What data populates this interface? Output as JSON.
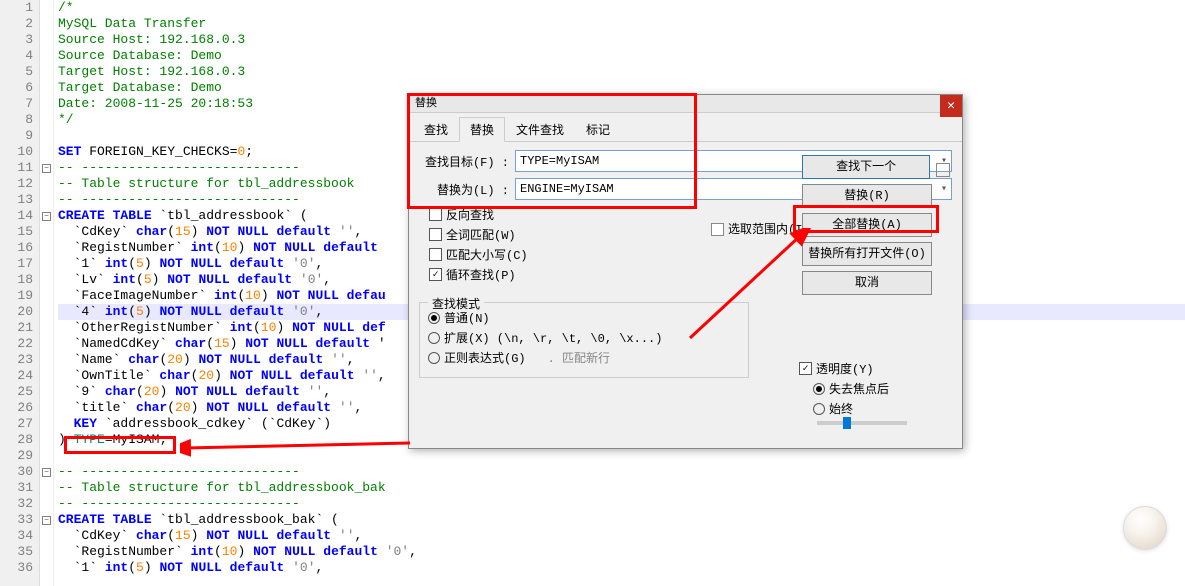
{
  "editor": {
    "lines": [
      {
        "n": 1,
        "f": "",
        "seg": [
          {
            "c": "c-comment",
            "t": "/*"
          }
        ]
      },
      {
        "n": 2,
        "f": "",
        "seg": [
          {
            "c": "c-comment",
            "t": "MySQL Data Transfer"
          }
        ]
      },
      {
        "n": 3,
        "f": "",
        "seg": [
          {
            "c": "c-comment",
            "t": "Source Host: 192.168.0.3"
          }
        ]
      },
      {
        "n": 4,
        "f": "",
        "seg": [
          {
            "c": "c-comment",
            "t": "Source Database: Demo"
          }
        ]
      },
      {
        "n": 5,
        "f": "",
        "seg": [
          {
            "c": "c-comment",
            "t": "Target Host: 192.168.0.3"
          }
        ]
      },
      {
        "n": 6,
        "f": "",
        "seg": [
          {
            "c": "c-comment",
            "t": "Target Database: Demo"
          }
        ]
      },
      {
        "n": 7,
        "f": "",
        "seg": [
          {
            "c": "c-comment",
            "t": "Date: 2008-11-25 20:18:53"
          }
        ]
      },
      {
        "n": 8,
        "f": "",
        "seg": [
          {
            "c": "c-comment",
            "t": "*/"
          }
        ]
      },
      {
        "n": 9,
        "f": "",
        "seg": [
          {
            "c": "",
            "t": ""
          }
        ]
      },
      {
        "n": 10,
        "f": "",
        "seg": [
          {
            "c": "c-kw",
            "t": "SET"
          },
          {
            "c": "",
            "t": " FOREIGN_KEY_CHECKS="
          },
          {
            "c": "c-num",
            "t": "0"
          },
          {
            "c": "",
            "t": ";"
          }
        ]
      },
      {
        "n": 11,
        "f": "-",
        "seg": [
          {
            "c": "c-comment",
            "t": "-- ----------------------------"
          }
        ]
      },
      {
        "n": 12,
        "f": "",
        "seg": [
          {
            "c": "c-comment",
            "t": "-- Table structure for tbl_addressbook"
          }
        ]
      },
      {
        "n": 13,
        "f": "",
        "seg": [
          {
            "c": "c-comment",
            "t": "-- ----------------------------"
          }
        ]
      },
      {
        "n": 14,
        "f": "-",
        "seg": [
          {
            "c": "c-kw",
            "t": "CREATE TABLE"
          },
          {
            "c": "",
            "t": " `tbl_addressbook` ("
          }
        ]
      },
      {
        "n": 15,
        "f": "",
        "seg": [
          {
            "c": "",
            "t": "  `CdKey` "
          },
          {
            "c": "c-kw",
            "t": "char"
          },
          {
            "c": "",
            "t": "("
          },
          {
            "c": "c-num",
            "t": "15"
          },
          {
            "c": "",
            "t": ") "
          },
          {
            "c": "c-kw",
            "t": "NOT NULL default"
          },
          {
            "c": "",
            "t": " "
          },
          {
            "c": "c-str",
            "t": "''"
          },
          {
            "c": "",
            "t": ","
          }
        ]
      },
      {
        "n": 16,
        "f": "",
        "seg": [
          {
            "c": "",
            "t": "  `RegistNumber` "
          },
          {
            "c": "c-kw",
            "t": "int"
          },
          {
            "c": "",
            "t": "("
          },
          {
            "c": "c-num",
            "t": "10"
          },
          {
            "c": "",
            "t": ") "
          },
          {
            "c": "c-kw",
            "t": "NOT NULL default"
          },
          {
            "c": "",
            "t": " "
          }
        ]
      },
      {
        "n": 17,
        "f": "",
        "seg": [
          {
            "c": "",
            "t": "  `1` "
          },
          {
            "c": "c-kw",
            "t": "int"
          },
          {
            "c": "",
            "t": "("
          },
          {
            "c": "c-num",
            "t": "5"
          },
          {
            "c": "",
            "t": ") "
          },
          {
            "c": "c-kw",
            "t": "NOT NULL default"
          },
          {
            "c": "",
            "t": " "
          },
          {
            "c": "c-str",
            "t": "'0'"
          },
          {
            "c": "",
            "t": ","
          }
        ]
      },
      {
        "n": 18,
        "f": "",
        "seg": [
          {
            "c": "",
            "t": "  `Lv` "
          },
          {
            "c": "c-kw",
            "t": "int"
          },
          {
            "c": "",
            "t": "("
          },
          {
            "c": "c-num",
            "t": "5"
          },
          {
            "c": "",
            "t": ") "
          },
          {
            "c": "c-kw",
            "t": "NOT NULL default"
          },
          {
            "c": "",
            "t": " "
          },
          {
            "c": "c-str",
            "t": "'0'"
          },
          {
            "c": "",
            "t": ","
          }
        ]
      },
      {
        "n": 19,
        "f": "",
        "seg": [
          {
            "c": "",
            "t": "  `FaceImageNumber` "
          },
          {
            "c": "c-kw",
            "t": "int"
          },
          {
            "c": "",
            "t": "("
          },
          {
            "c": "c-num",
            "t": "10"
          },
          {
            "c": "",
            "t": ") "
          },
          {
            "c": "c-kw",
            "t": "NOT NULL defau"
          }
        ]
      },
      {
        "n": 20,
        "f": "",
        "hl": true,
        "seg": [
          {
            "c": "",
            "t": "  `4` "
          },
          {
            "c": "c-kw",
            "t": "int"
          },
          {
            "c": "",
            "t": "("
          },
          {
            "c": "c-num",
            "t": "5"
          },
          {
            "c": "",
            "t": ") "
          },
          {
            "c": "c-kw",
            "t": "NOT NULL default"
          },
          {
            "c": "",
            "t": " "
          },
          {
            "c": "c-str",
            "t": "'0'"
          },
          {
            "c": "",
            "t": ","
          }
        ]
      },
      {
        "n": 21,
        "f": "",
        "seg": [
          {
            "c": "",
            "t": "  `OtherRegistNumber` "
          },
          {
            "c": "c-kw",
            "t": "int"
          },
          {
            "c": "",
            "t": "("
          },
          {
            "c": "c-num",
            "t": "10"
          },
          {
            "c": "",
            "t": ") "
          },
          {
            "c": "c-kw",
            "t": "NOT NULL def"
          }
        ]
      },
      {
        "n": 22,
        "f": "",
        "seg": [
          {
            "c": "",
            "t": "  `NamedCdKey` "
          },
          {
            "c": "c-kw",
            "t": "char"
          },
          {
            "c": "",
            "t": "("
          },
          {
            "c": "c-num",
            "t": "15"
          },
          {
            "c": "",
            "t": ") "
          },
          {
            "c": "c-kw",
            "t": "NOT NULL default"
          },
          {
            "c": "",
            "t": " '"
          }
        ]
      },
      {
        "n": 23,
        "f": "",
        "seg": [
          {
            "c": "",
            "t": "  `Name` "
          },
          {
            "c": "c-kw",
            "t": "char"
          },
          {
            "c": "",
            "t": "("
          },
          {
            "c": "c-num",
            "t": "20"
          },
          {
            "c": "",
            "t": ") "
          },
          {
            "c": "c-kw",
            "t": "NOT NULL default"
          },
          {
            "c": "",
            "t": " "
          },
          {
            "c": "c-str",
            "t": "''"
          },
          {
            "c": "",
            "t": ","
          }
        ]
      },
      {
        "n": 24,
        "f": "",
        "seg": [
          {
            "c": "",
            "t": "  `OwnTitle` "
          },
          {
            "c": "c-kw",
            "t": "char"
          },
          {
            "c": "",
            "t": "("
          },
          {
            "c": "c-num",
            "t": "20"
          },
          {
            "c": "",
            "t": ") "
          },
          {
            "c": "c-kw",
            "t": "NOT NULL default"
          },
          {
            "c": "",
            "t": " "
          },
          {
            "c": "c-str",
            "t": "''"
          },
          {
            "c": "",
            "t": ","
          }
        ]
      },
      {
        "n": 25,
        "f": "",
        "seg": [
          {
            "c": "",
            "t": "  `9` "
          },
          {
            "c": "c-kw",
            "t": "char"
          },
          {
            "c": "",
            "t": "("
          },
          {
            "c": "c-num",
            "t": "20"
          },
          {
            "c": "",
            "t": ") "
          },
          {
            "c": "c-kw",
            "t": "NOT NULL default"
          },
          {
            "c": "",
            "t": " "
          },
          {
            "c": "c-str",
            "t": "''"
          },
          {
            "c": "",
            "t": ","
          }
        ]
      },
      {
        "n": 26,
        "f": "",
        "seg": [
          {
            "c": "",
            "t": "  `title` "
          },
          {
            "c": "c-kw",
            "t": "char"
          },
          {
            "c": "",
            "t": "("
          },
          {
            "c": "c-num",
            "t": "20"
          },
          {
            "c": "",
            "t": ") "
          },
          {
            "c": "c-kw",
            "t": "NOT NULL default"
          },
          {
            "c": "",
            "t": " "
          },
          {
            "c": "c-str",
            "t": "''"
          },
          {
            "c": "",
            "t": ","
          }
        ]
      },
      {
        "n": 27,
        "f": "",
        "seg": [
          {
            "c": "",
            "t": "  "
          },
          {
            "c": "c-kw",
            "t": "KEY"
          },
          {
            "c": "",
            "t": " `addressbook_cdkey` (`CdKey`)"
          }
        ]
      },
      {
        "n": 28,
        "f": "",
        "seg": [
          {
            "c": "",
            "t": ") "
          },
          {
            "c": "c-teal",
            "t": "TYPE"
          },
          {
            "c": "",
            "t": "=MyISAM;"
          }
        ]
      },
      {
        "n": 29,
        "f": "",
        "seg": [
          {
            "c": "",
            "t": ""
          }
        ]
      },
      {
        "n": 30,
        "f": "-",
        "seg": [
          {
            "c": "c-comment",
            "t": "-- ----------------------------"
          }
        ]
      },
      {
        "n": 31,
        "f": "",
        "seg": [
          {
            "c": "c-comment",
            "t": "-- Table structure for tbl_addressbook_bak"
          }
        ]
      },
      {
        "n": 32,
        "f": "",
        "seg": [
          {
            "c": "c-comment",
            "t": "-- ----------------------------"
          }
        ]
      },
      {
        "n": 33,
        "f": "-",
        "seg": [
          {
            "c": "c-kw",
            "t": "CREATE TABLE"
          },
          {
            "c": "",
            "t": " `tbl_addressbook_bak` ("
          }
        ]
      },
      {
        "n": 34,
        "f": "",
        "seg": [
          {
            "c": "",
            "t": "  `CdKey` "
          },
          {
            "c": "c-kw",
            "t": "char"
          },
          {
            "c": "",
            "t": "("
          },
          {
            "c": "c-num",
            "t": "15"
          },
          {
            "c": "",
            "t": ") "
          },
          {
            "c": "c-kw",
            "t": "NOT NULL default"
          },
          {
            "c": "",
            "t": " "
          },
          {
            "c": "c-str",
            "t": "''"
          },
          {
            "c": "",
            "t": ","
          }
        ]
      },
      {
        "n": 35,
        "f": "",
        "seg": [
          {
            "c": "",
            "t": "  `RegistNumber` "
          },
          {
            "c": "c-kw",
            "t": "int"
          },
          {
            "c": "",
            "t": "("
          },
          {
            "c": "c-num",
            "t": "10"
          },
          {
            "c": "",
            "t": ") "
          },
          {
            "c": "c-kw",
            "t": "NOT NULL default"
          },
          {
            "c": "",
            "t": " "
          },
          {
            "c": "c-str",
            "t": "'0'"
          },
          {
            "c": "",
            "t": ","
          }
        ]
      },
      {
        "n": 36,
        "f": "",
        "seg": [
          {
            "c": "",
            "t": "  `1` "
          },
          {
            "c": "c-kw",
            "t": "int"
          },
          {
            "c": "",
            "t": "("
          },
          {
            "c": "c-num",
            "t": "5"
          },
          {
            "c": "",
            "t": ") "
          },
          {
            "c": "c-kw",
            "t": "NOT NULL default"
          },
          {
            "c": "",
            "t": " "
          },
          {
            "c": "c-str",
            "t": "'0'"
          },
          {
            "c": "",
            "t": ","
          }
        ]
      }
    ]
  },
  "dialog": {
    "title": "替换",
    "tabs": [
      "查找",
      "替换",
      "文件查找",
      "标记"
    ],
    "active_tab": 1,
    "find_label": "查找目标(F) :",
    "find_value": "TYPE=MyISAM",
    "replace_label": "替换为(L) :",
    "replace_value": "ENGINE=MyISAM",
    "in_selection": "选取范围内(I)",
    "buttons": {
      "find_next": "查找下一个",
      "replace": "替换(R)",
      "replace_all": "全部替换(A)",
      "replace_in_all": "替换所有打开文件(O)",
      "cancel": "取消"
    },
    "checks": {
      "backward": "反向查找",
      "whole_word": "全词匹配(W)",
      "match_case": "匹配大小写(C)",
      "wrap": "循环查找(P)"
    },
    "mode": {
      "title": "查找模式",
      "normal": "普通(N)",
      "extended": "扩展(X) (\\n, \\r, \\t, \\0, \\x...)",
      "regex": "正则表达式(G)",
      "dotall": ". 匹配新行"
    },
    "transparency": {
      "enable": "透明度(Y)",
      "on_lose": "失去焦点后",
      "always": "始终"
    }
  }
}
